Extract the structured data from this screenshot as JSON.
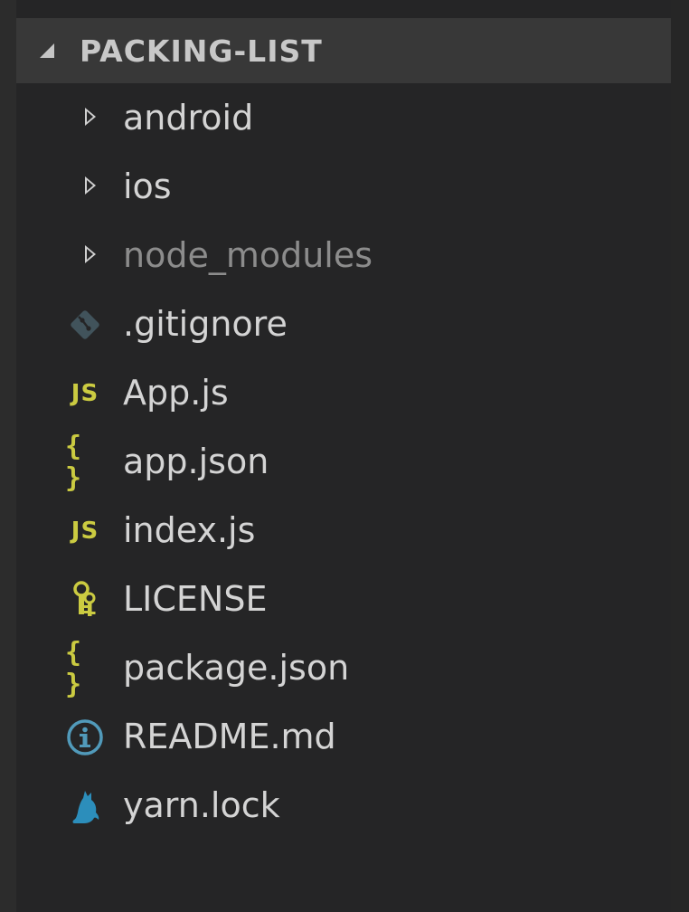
{
  "explorer": {
    "section_title": "PACKING-LIST",
    "items": [
      {
        "label": "android",
        "type": "folder",
        "icon": "chevron-right-icon",
        "dim": false
      },
      {
        "label": "ios",
        "type": "folder",
        "icon": "chevron-right-icon",
        "dim": false
      },
      {
        "label": "node_modules",
        "type": "folder",
        "icon": "chevron-right-icon",
        "dim": true
      },
      {
        "label": ".gitignore",
        "type": "file",
        "icon": "git-icon",
        "dim": false
      },
      {
        "label": "App.js",
        "type": "file",
        "icon": "javascript-icon",
        "icon_text": "JS",
        "dim": false
      },
      {
        "label": "app.json",
        "type": "file",
        "icon": "json-braces-icon",
        "icon_text": "{ }",
        "dim": false
      },
      {
        "label": "index.js",
        "type": "file",
        "icon": "javascript-icon",
        "icon_text": "JS",
        "dim": false
      },
      {
        "label": "LICENSE",
        "type": "file",
        "icon": "license-key-icon",
        "dim": false
      },
      {
        "label": "package.json",
        "type": "file",
        "icon": "json-braces-icon",
        "icon_text": "{ }",
        "dim": false
      },
      {
        "label": "README.md",
        "type": "file",
        "icon": "info-icon",
        "dim": false
      },
      {
        "label": "yarn.lock",
        "type": "file",
        "icon": "yarn-cat-icon",
        "dim": false
      }
    ]
  },
  "colors": {
    "background": "#252526",
    "header_background": "#383838",
    "text": "#d4d4d4",
    "dim_text": "#8c8c8c",
    "js_yellow": "#cbcb41",
    "git_slate": "#41535b",
    "info_blue": "#519aba"
  }
}
